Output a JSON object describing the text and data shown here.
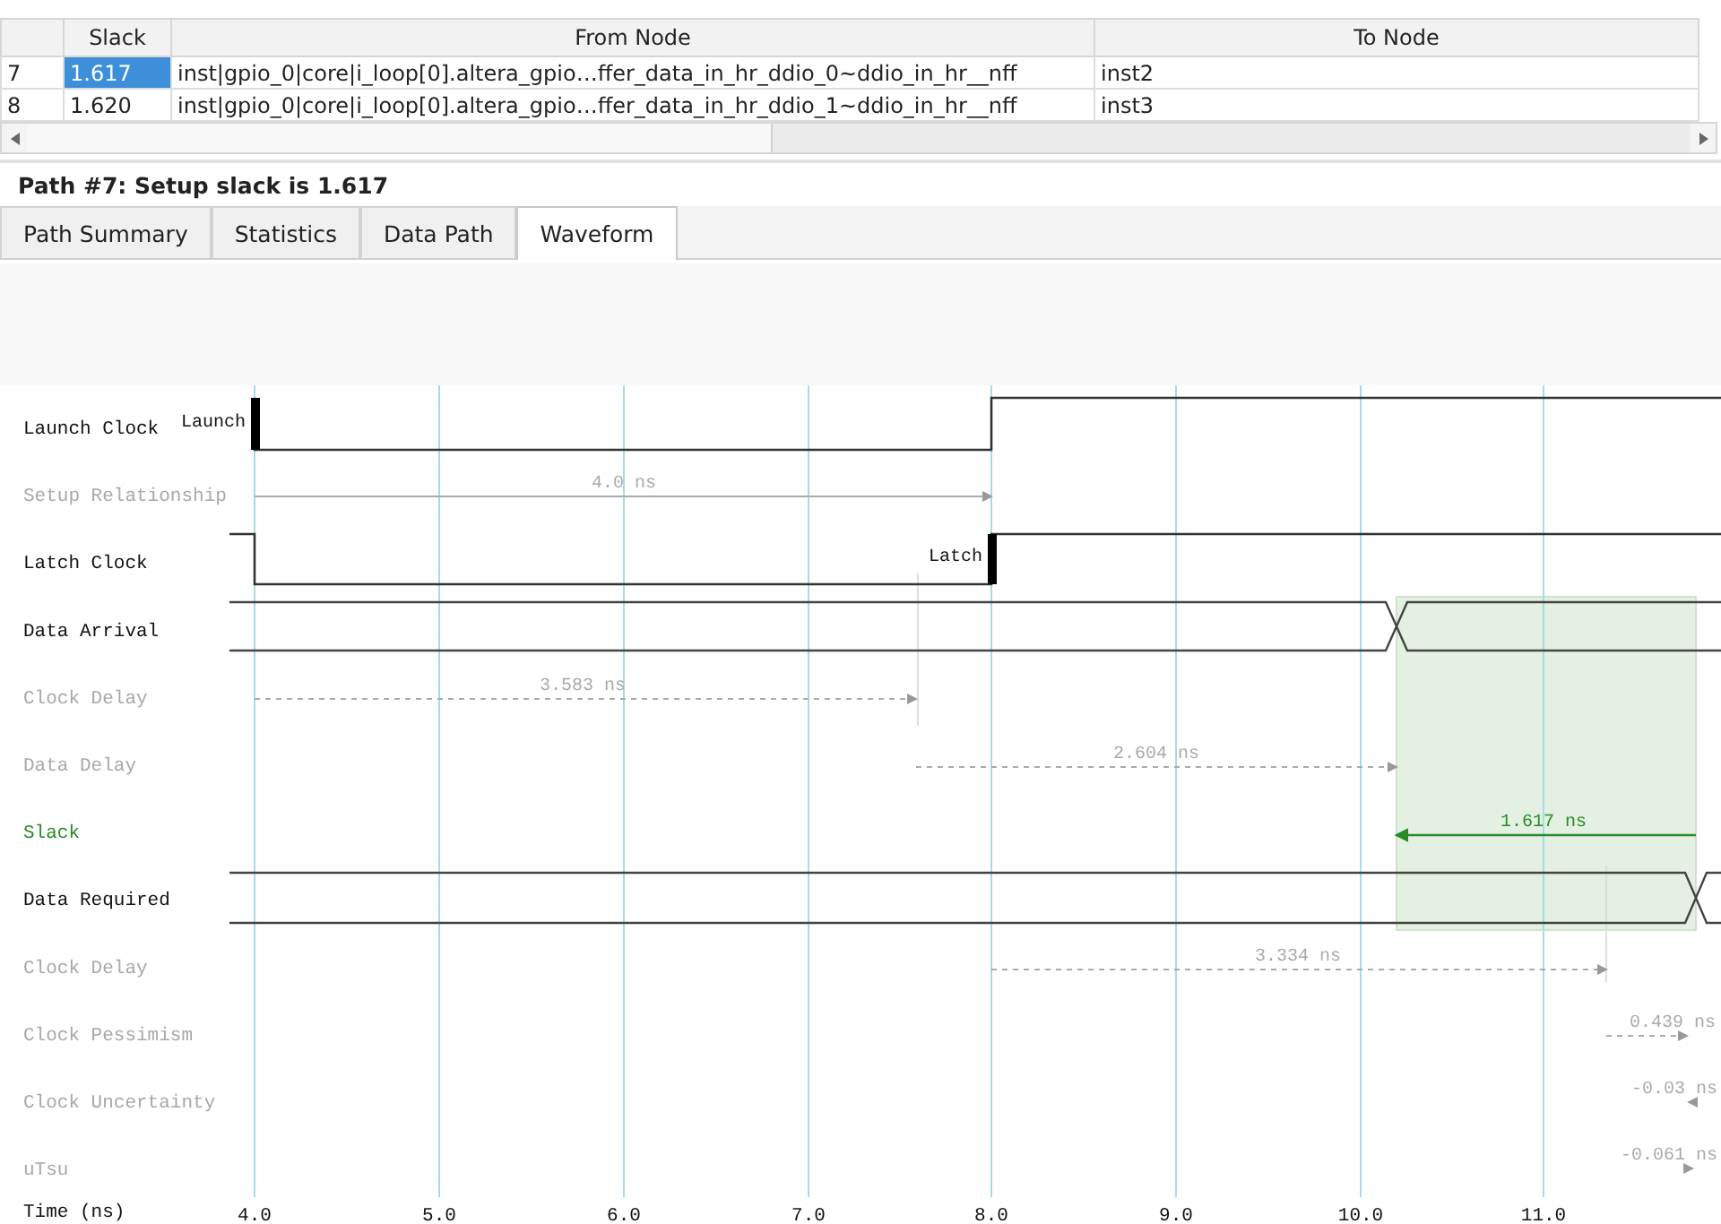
{
  "results_table": {
    "columns": [
      "Slack",
      "From Node",
      "To Node"
    ],
    "rows": [
      {
        "index": "7",
        "slack": "1.617",
        "from_node": "inst|gpio_0|core|i_loop[0].altera_gpio…ffer_data_in_hr_ddio_0~ddio_in_hr__nff",
        "to_node": "inst2",
        "selected": true
      },
      {
        "index": "8",
        "slack": "1.620",
        "from_node": "inst|gpio_0|core|i_loop[0].altera_gpio…ffer_data_in_hr_ddio_1~ddio_in_hr__nff",
        "to_node": "inst3",
        "selected": false
      }
    ]
  },
  "path_title": "Path #7: Setup slack is 1.617",
  "tabs": [
    {
      "label": "Path Summary",
      "selected": false
    },
    {
      "label": "Statistics",
      "selected": false
    },
    {
      "label": "Data Path",
      "selected": false
    },
    {
      "label": "Waveform",
      "selected": true
    }
  ],
  "waveform": {
    "rows": [
      {
        "label": "Launch Clock",
        "kind": "clock",
        "marker": "Launch"
      },
      {
        "label": "Setup Relationship",
        "kind": "delay",
        "value": "4.0 ns"
      },
      {
        "label": "Latch Clock",
        "kind": "clock",
        "marker": "Latch"
      },
      {
        "label": "Data Arrival",
        "kind": "bus"
      },
      {
        "label": "Clock Delay",
        "kind": "delay",
        "value": "3.583 ns"
      },
      {
        "label": "Data Delay",
        "kind": "delay",
        "value": "2.604 ns"
      },
      {
        "label": "Slack",
        "kind": "slack",
        "value": "1.617 ns"
      },
      {
        "label": "Data Required",
        "kind": "bus"
      },
      {
        "label": "Clock Delay",
        "kind": "delay",
        "value": "3.334 ns"
      },
      {
        "label": "Clock Pessimism",
        "kind": "delay",
        "value": "0.439 ns"
      },
      {
        "label": "Clock Uncertainty",
        "kind": "delay",
        "value": "-0.03 ns"
      },
      {
        "label": "uTsu",
        "kind": "delay",
        "value": "-0.061 ns"
      }
    ],
    "axis": {
      "label": "Time (ns)",
      "ticks": [
        "4.0",
        "5.0",
        "6.0",
        "7.0",
        "8.0",
        "9.0",
        "10.0",
        "11.0"
      ]
    }
  }
}
